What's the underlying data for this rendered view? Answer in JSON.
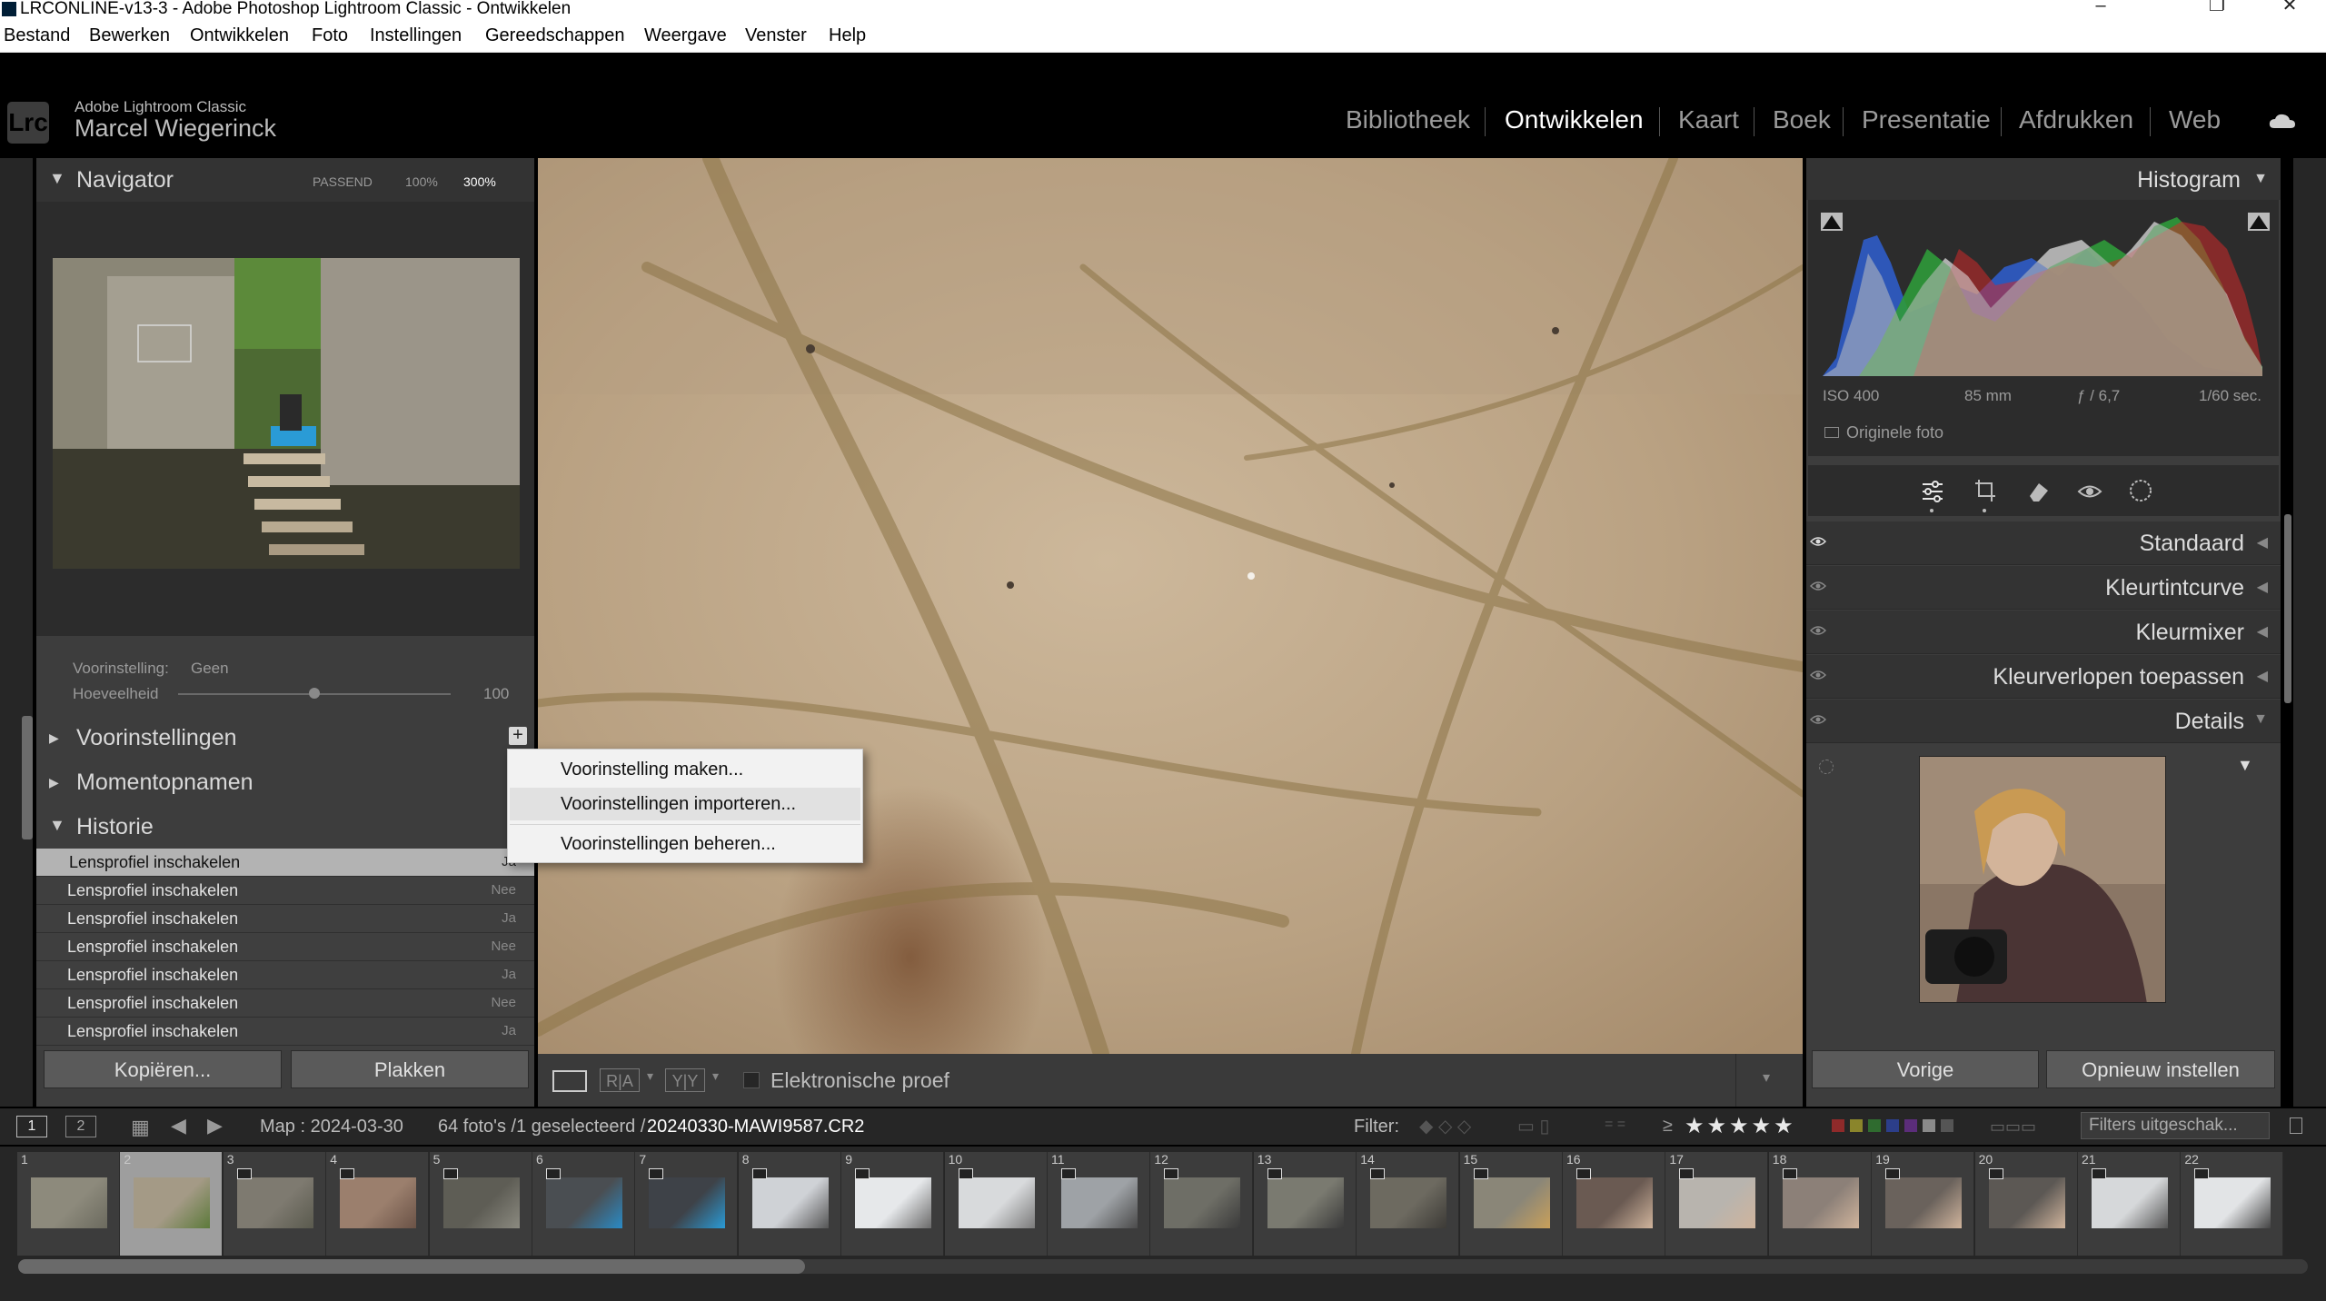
{
  "window": {
    "title": "LRCONLINE-v13-3 - Adobe Photoshop Lightroom Classic - Ontwikkelen",
    "minimize_glyph": "–",
    "maximize_glyph": "❐",
    "close_glyph": "✕"
  },
  "menu": [
    "Bestand",
    "Bewerken",
    "Ontwikkelen",
    "Foto",
    "Instellingen",
    "Gereedschappen",
    "Weergave",
    "Venster",
    "Help"
  ],
  "identity": {
    "logo": "Lrc",
    "product": "Adobe Lightroom Classic",
    "user": "Marcel Wiegerinck"
  },
  "modules": [
    "Bibliotheek",
    "Ontwikkelen",
    "Kaart",
    "Boek",
    "Presentatie",
    "Afdrukken",
    "Web"
  ],
  "active_module": "Ontwikkelen",
  "navigator": {
    "title": "Navigator",
    "zoom_options": [
      "PASSEND",
      "100%",
      "300%"
    ],
    "selected_zoom": "300%"
  },
  "preset_amount": {
    "preset_label": "Voorinstelling:",
    "preset_value": "Geen",
    "amount_label": "Hoeveelheid",
    "amount_value": "100",
    "slider_fraction": 0.5
  },
  "left_sections": {
    "presets": "Voorinstellingen",
    "snapshots": "Momentopnamen",
    "history": "Historie",
    "add_glyph": "+"
  },
  "history": [
    {
      "name": "Lensprofiel inschakelen",
      "value": "Ja",
      "selected": true
    },
    {
      "name": "Lensprofiel inschakelen",
      "value": "Nee"
    },
    {
      "name": "Lensprofiel inschakelen",
      "value": "Ja"
    },
    {
      "name": "Lensprofiel inschakelen",
      "value": "Nee"
    },
    {
      "name": "Lensprofiel inschakelen",
      "value": "Ja"
    },
    {
      "name": "Lensprofiel inschakelen",
      "value": "Nee"
    },
    {
      "name": "Lensprofiel inschakelen",
      "value": "Ja"
    }
  ],
  "left_buttons": {
    "copy": "Kopiëren...",
    "paste": "Plakken"
  },
  "context_menu": [
    "Voorinstelling maken...",
    "Voorinstellingen importeren...",
    "Voorinstellingen beheren..."
  ],
  "context_menu_highlighted": 1,
  "histogram": {
    "title": "Histogram",
    "iso": "ISO 400",
    "focal": "85 mm",
    "aperture": "ƒ / 6,7",
    "shutter": "1/60 sec.",
    "original_photo": "Originele foto"
  },
  "tools": [
    "edit-sliders-icon",
    "crop-icon",
    "eraser-icon",
    "red-eye-icon",
    "masking-icon"
  ],
  "right_panels": [
    "Standaard",
    "Kleurtintcurve",
    "Kleurmixer",
    "Kleurverlopen toepassen",
    "Details"
  ],
  "right_buttons": {
    "previous": "Vorige",
    "reset": "Opnieuw instellen"
  },
  "toolbar": {
    "loupe_icon": "loupe-view-icon",
    "before_after_label": "R|A",
    "yy_label": "Y|Y",
    "soft_proof": "Elektronische proef"
  },
  "filmstrip": {
    "view1": "1",
    "view2": "2",
    "source": "Map : 2024-03-30",
    "count": "64 foto's /1 geselecteerd /",
    "filename": "20240330-MAWI9587.CR2",
    "filter_label": "Filter:",
    "ge_symbol": "≥",
    "stars": "★★★★★",
    "filter_state": "Filters uitgeschak...",
    "numbers": [
      "1",
      "2",
      "3",
      "4",
      "5",
      "6",
      "7",
      "8",
      "9",
      "10",
      "11",
      "12",
      "13",
      "14",
      "15",
      "16",
      "17",
      "18",
      "19",
      "20",
      "21",
      "22"
    ],
    "selected_index": 1,
    "scroll_fraction": 0.34
  },
  "colors": {
    "accent_white": "#ffffff",
    "panel_bg": "#3d3d3d",
    "histogram_red": "#d02a2a",
    "histogram_green": "#2f9a3a",
    "histogram_blue": "#2f5cc8"
  }
}
